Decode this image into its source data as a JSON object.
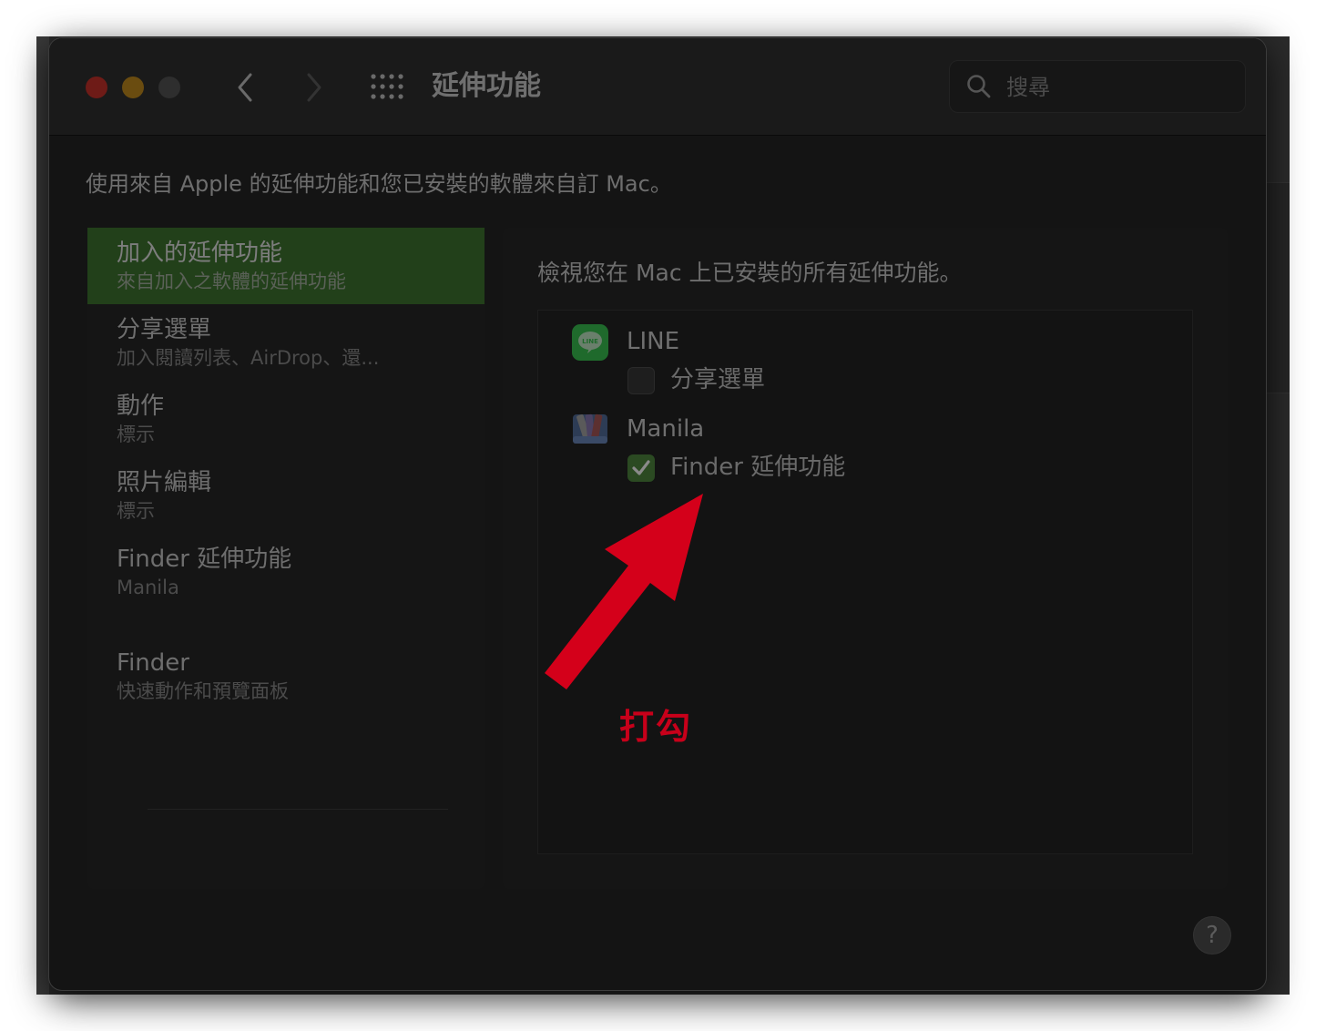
{
  "window": {
    "title": "延伸功能",
    "search_placeholder": "搜尋"
  },
  "description": "使用來自 Apple 的延伸功能和您已安裝的軟體來自訂 Mac。",
  "sidebar": {
    "items": [
      {
        "title": "加入的延伸功能",
        "subtitle": "來自加入之軟體的延伸功能",
        "selected": true
      },
      {
        "title": "分享選單",
        "subtitle": "加入閱讀列表、AirDrop、還..."
      },
      {
        "title": "動作",
        "subtitle": "標示"
      },
      {
        "title": "照片編輯",
        "subtitle": "標示"
      },
      {
        "title": "Finder 延伸功能",
        "subtitle": "Manila"
      },
      {
        "title": "Finder",
        "subtitle": "快速動作和預覽面板"
      }
    ]
  },
  "content": {
    "header": "檢視您在 Mac 上已安裝的所有延伸功能。",
    "apps": [
      {
        "name": "LINE",
        "icon": "line-app-icon",
        "extension": {
          "label": "分享選單",
          "checked": false
        }
      },
      {
        "name": "Manila",
        "icon": "manila-app-icon",
        "extension": {
          "label": "Finder 延伸功能",
          "checked": true
        }
      }
    ]
  },
  "help": {
    "label": "?"
  },
  "annotation": {
    "text": "打勾",
    "color": "#c8001a"
  },
  "colors": {
    "selected_row": "#22401a",
    "checkbox_checked": "#2b4a22",
    "annotation_red": "#d4001a"
  }
}
